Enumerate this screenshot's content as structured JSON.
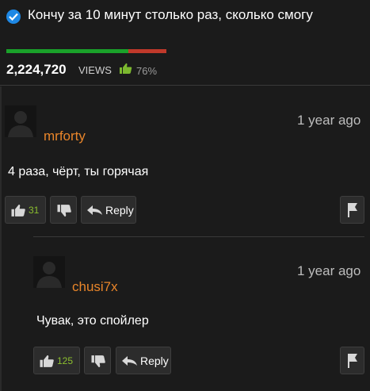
{
  "video": {
    "title": "Кончу за 10 минут столько раз, сколько смогу",
    "views_count": "2,224,720",
    "views_label": "VIEWS",
    "rating_percent": "76%",
    "rating_fraction": 0.76
  },
  "comments": [
    {
      "username": "mrforty",
      "time": "1 year ago",
      "text": "4 раза, чёрт, ты горячая",
      "likes": "31",
      "reply_label": "Reply"
    },
    {
      "username": "chusi7x",
      "time": "1 year ago",
      "text": "Чувак, это спойлер",
      "likes": "125",
      "reply_label": "Reply"
    }
  ],
  "colors": {
    "accent_blue": "#1e88e5",
    "username_orange": "#e8852a",
    "like_green": "#8cbf2f",
    "bar_green": "#1aa12a",
    "bar_red": "#c0392b"
  },
  "icons": [
    "check-circle-icon",
    "thumbs-up-icon",
    "thumbs-down-icon",
    "reply-arrow-icon",
    "flag-icon",
    "avatar-silhouette-icon"
  ]
}
